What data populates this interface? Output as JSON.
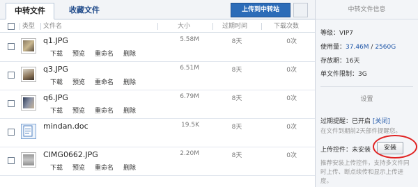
{
  "tabs": {
    "active": "中转文件",
    "inactive": "收藏文件"
  },
  "toolbar": {
    "upload_label": "上传到中转站"
  },
  "table": {
    "headers": {
      "type": "类型",
      "name": "文件名",
      "size": "大小",
      "expire": "过期时间",
      "downloads": "下载次数"
    },
    "actions": [
      "下载",
      "预览",
      "重命名",
      "删除"
    ],
    "rows": [
      {
        "name": "q1.JPG",
        "size": "5.58M",
        "expire": "8天",
        "downloads": "0次",
        "icon": "image-thumbnail-icon"
      },
      {
        "name": "q3.JPG",
        "size": "6.51M",
        "expire": "8天",
        "downloads": "0次",
        "icon": "image-thumbnail-icon"
      },
      {
        "name": "q6.JPG",
        "size": "6.79M",
        "expire": "8天",
        "downloads": "0次",
        "icon": "image-thumbnail-icon"
      },
      {
        "name": "mindan.doc",
        "size": "19.5K",
        "expire": "8天",
        "downloads": "0次",
        "icon": "word-document-icon"
      },
      {
        "name": "CIMG0662.JPG",
        "size": "2.20M",
        "expire": "8天",
        "downloads": "0次",
        "icon": "image-thumbnail-icon"
      }
    ]
  },
  "sidebar": {
    "title": "中转文件信息",
    "level_label": "等级：",
    "level_value": "VIP7",
    "used_label": "使用量：",
    "used_value": "37.46M",
    "used_sep": " / ",
    "used_total": "2560G",
    "retention_label": "存放期：",
    "retention_value": "16天",
    "limit_label": "单文件限制：",
    "limit_value": "3G",
    "settings_title": "设置",
    "expiry_label": "过期提醒：",
    "expiry_value": "已开启",
    "expiry_link": "[关闭]",
    "expiry_note": "在文件到期前2天部件提醒您。",
    "plugin_label": "上传控件：",
    "plugin_value": "未安装",
    "install_label": "安装",
    "plugin_note": "推荐安装上传控件，支持多文件同时上传、断点续传和显示上传进度。"
  },
  "colors": {
    "accent": "#2c6cb8",
    "link": "#1f56a8",
    "highlight": "#e02020"
  }
}
